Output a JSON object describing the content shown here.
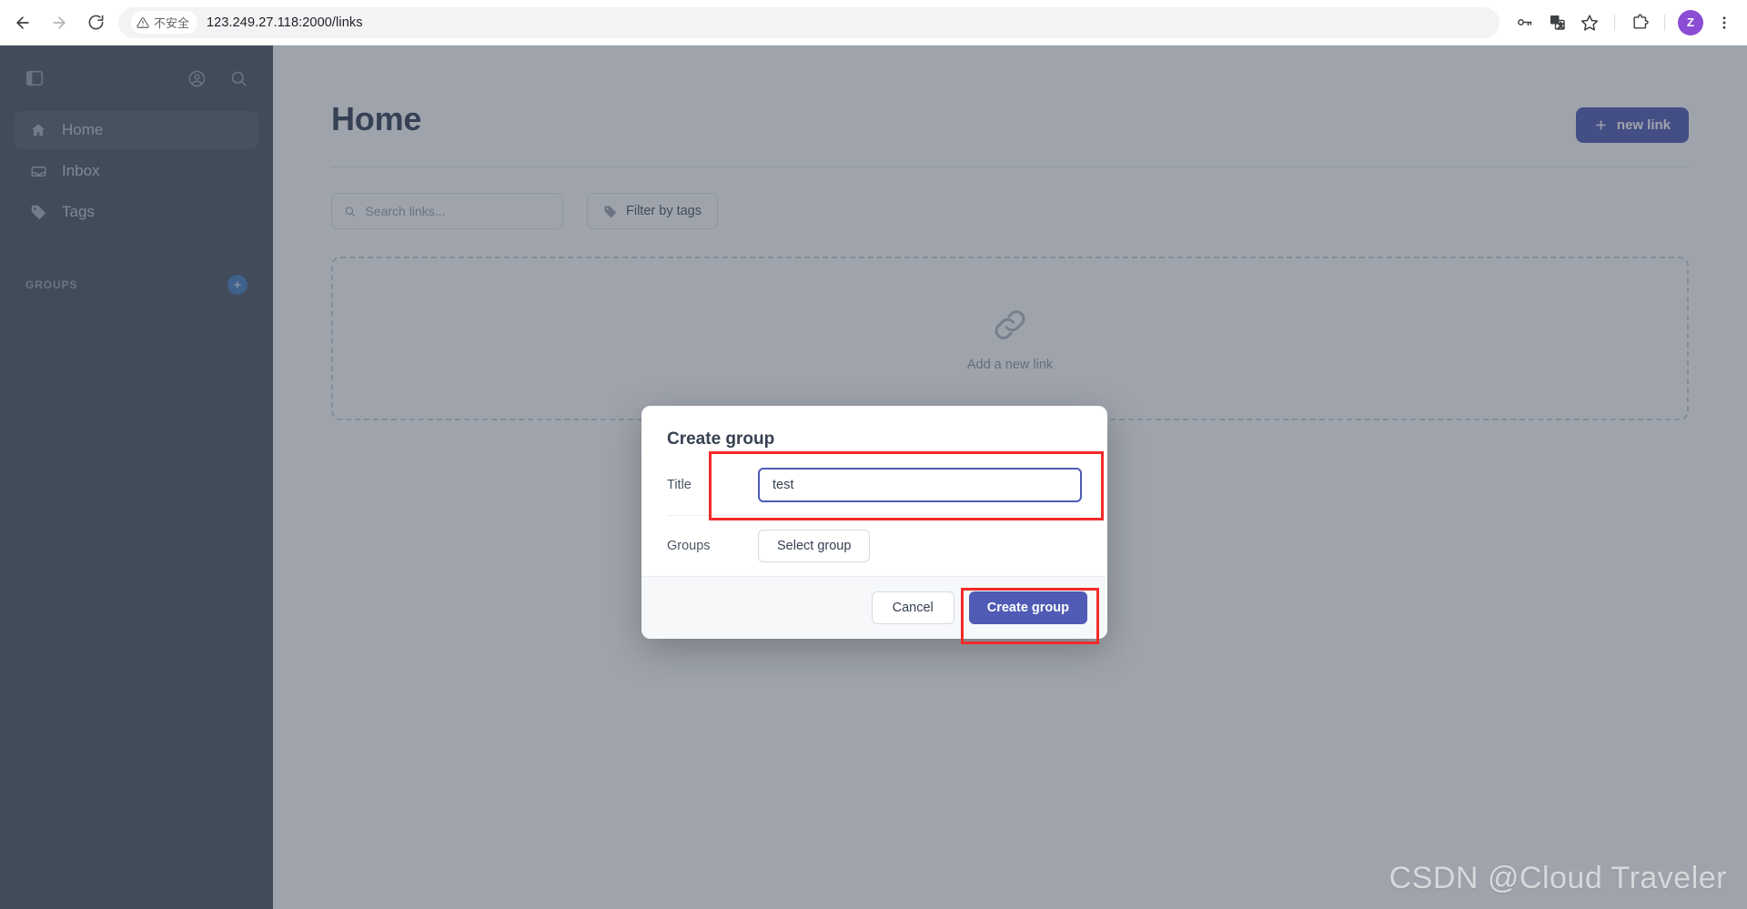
{
  "browser": {
    "back_label": "Back",
    "forward_label": "Forward",
    "reload_label": "Reload",
    "security_warning": "不安全",
    "url": "123.249.27.118:2000/links",
    "toolbar_icons": [
      "password-key-icon",
      "translate-icon",
      "bookmark-star-icon",
      "extensions-puzzle-icon"
    ],
    "profile_initial": "Z",
    "menu_label": "Customize and control Google Chrome"
  },
  "sidebar": {
    "toggle_label": "Toggle sidebar",
    "account_label": "Account",
    "search_label": "Search",
    "items": [
      {
        "label": "Home",
        "icon": "home-icon",
        "active": true
      },
      {
        "label": "Inbox",
        "icon": "inbox-icon",
        "active": false
      },
      {
        "label": "Tags",
        "icon": "tag-icon",
        "active": false
      }
    ],
    "groups_label": "GROUPS",
    "add_group_label": "+"
  },
  "main": {
    "page_title": "Home",
    "new_link_label": "new link",
    "search": {
      "value": "",
      "placeholder": "Search links..."
    },
    "filter_tags_label": "Filter by tags",
    "dropzone_label": "Add a new link"
  },
  "modal": {
    "title": "Create group",
    "title_field": {
      "label": "Title",
      "value": "test",
      "placeholder": ""
    },
    "groups_field": {
      "label": "Groups",
      "button_label": "Select group"
    },
    "cancel_label": "Cancel",
    "submit_label": "Create group"
  },
  "watermark": "CSDN @Cloud Traveler",
  "colors": {
    "accent_indigo": "#4f5bb5",
    "sidebar_bg": "#4b5563",
    "annotation_red": "#f42a2a",
    "avatar_purple": "#8c4dd4",
    "group_add_blue": "#4a7fc1"
  }
}
